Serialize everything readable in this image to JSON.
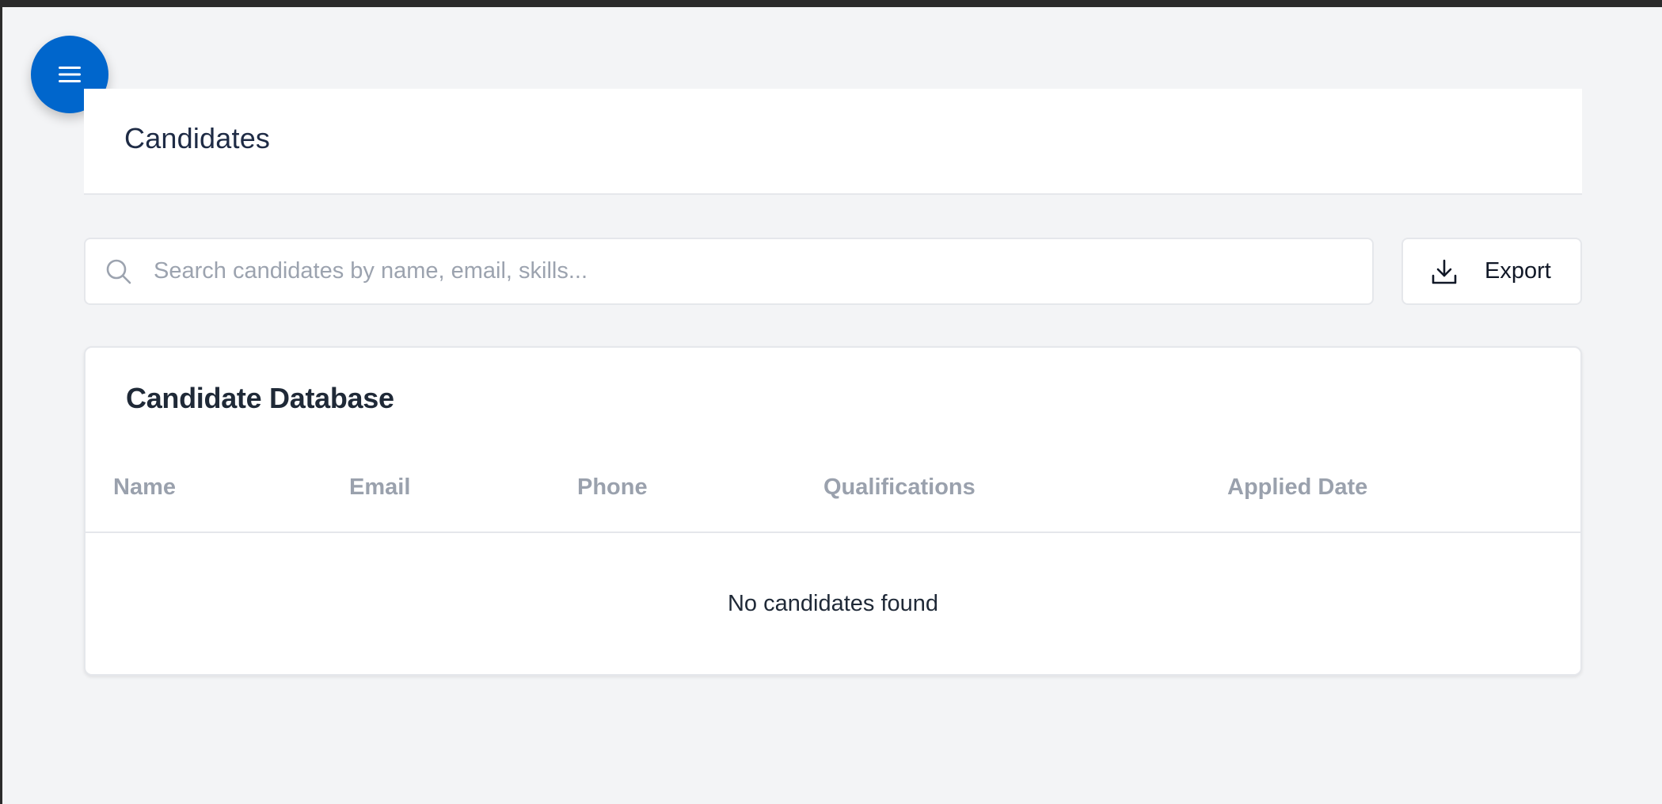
{
  "nav": {
    "menu_icon": "hamburger-icon",
    "accent_color": "#0066cc"
  },
  "header": {
    "title": "Candidates"
  },
  "search": {
    "placeholder": "Search candidates by name, email, skills...",
    "value": "",
    "icon": "search-icon"
  },
  "toolbar": {
    "export_label": "Export",
    "export_icon": "download-icon"
  },
  "candidate_table": {
    "title": "Candidate Database",
    "columns": [
      "Name",
      "Email",
      "Phone",
      "Qualifications",
      "Applied Date"
    ],
    "rows": [],
    "empty_message": "No candidates found"
  }
}
